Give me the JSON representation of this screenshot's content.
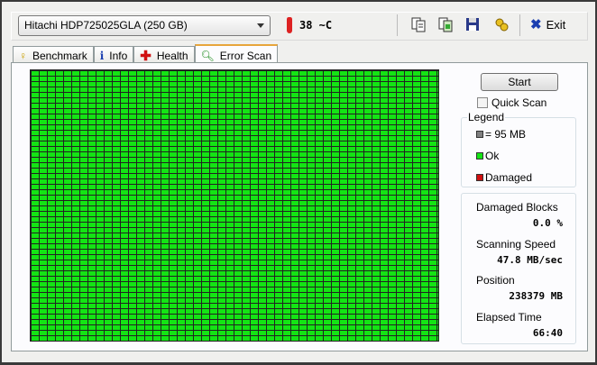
{
  "toolbar": {
    "drive": "Hitachi HDP725025GLA (250 GB)",
    "temperature": "38 ~C",
    "exit_label": "Exit"
  },
  "tabs": [
    {
      "label": "Benchmark"
    },
    {
      "label": "Info"
    },
    {
      "label": "Health"
    },
    {
      "label": "Error Scan"
    }
  ],
  "scan": {
    "start_label": "Start",
    "quick_scan_label": "Quick Scan",
    "quick_scan_checked": false
  },
  "legend": {
    "title": "Legend",
    "block_size": "= 95 MB",
    "ok": "Ok",
    "damaged": "Damaged",
    "colors": {
      "block": "#808080",
      "ok": "#14e414",
      "damaged": "#d01010"
    }
  },
  "stats": {
    "damaged_blocks_label": "Damaged Blocks",
    "damaged_blocks": "0.0 %",
    "speed_label": "Scanning Speed",
    "speed": "47.8 MB/sec",
    "position_label": "Position",
    "position": "238379 MB",
    "elapsed_label": "Elapsed Time",
    "elapsed": "66:40"
  }
}
